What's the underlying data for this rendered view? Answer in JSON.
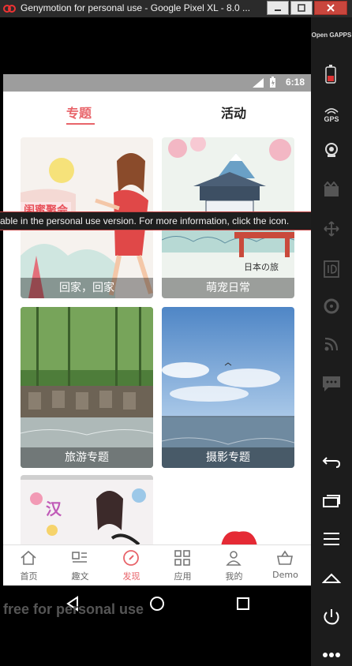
{
  "window": {
    "title": "Genymotion for personal use - Google Pixel XL - 8.0 ..."
  },
  "status_bar": {
    "time": "6:18"
  },
  "tabs": [
    {
      "label": "专题",
      "active": true
    },
    {
      "label": "活动",
      "active": false
    }
  ],
  "cards": [
    {
      "caption": "回家，回家",
      "image": "girl-running-illustration"
    },
    {
      "caption": "萌宠日常",
      "image": "japan-castle-illustration"
    },
    {
      "caption": "旅游专题",
      "image": "bamboo-forest-stream-photo"
    },
    {
      "caption": "摄影专题",
      "image": "sky-sea-photo"
    },
    {
      "caption": "",
      "image": "girl-flowers-illustration"
    }
  ],
  "card_text": {
    "card1_banner": "闺蜜聚会",
    "card2_banner": "日本の旅"
  },
  "toast": {
    "text": "able in the personal use version. For more information, click the icon."
  },
  "bottom_nav": [
    {
      "label": "首页",
      "icon": "home-icon",
      "active": false
    },
    {
      "label": "趣文",
      "icon": "article-icon",
      "active": false
    },
    {
      "label": "发现",
      "icon": "compass-icon",
      "active": true
    },
    {
      "label": "应用",
      "icon": "apps-icon",
      "active": false
    },
    {
      "label": "我的",
      "icon": "person-icon",
      "active": false
    },
    {
      "label": "Demo",
      "icon": "basket-icon",
      "active": false
    }
  ],
  "watermark": {
    "text": "free for personal use"
  },
  "side_panel": {
    "opengapps_label": "Open GAPPS",
    "gps_label": "GPS"
  },
  "colors": {
    "accent": "#e8646a",
    "status_bar": "#9d9d9d"
  }
}
